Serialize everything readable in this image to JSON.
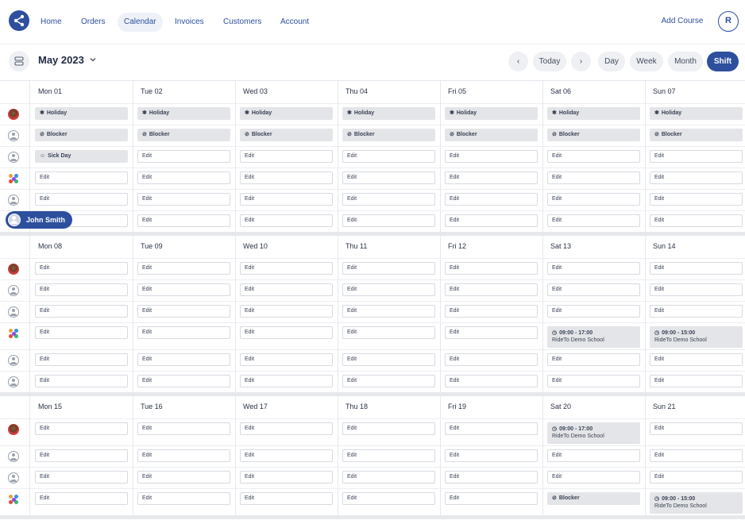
{
  "nav": {
    "items": [
      "Home",
      "Orders",
      "Calendar",
      "Invoices",
      "Customers",
      "Account"
    ],
    "active": "Calendar",
    "add_course": "Add Course",
    "account_initial": "R"
  },
  "toolbar": {
    "month": "May 2023",
    "today": "Today",
    "views": [
      "Day",
      "Week",
      "Month",
      "Shift"
    ],
    "active_view": "Shift"
  },
  "floating_label": "John Smith",
  "weeks": [
    {
      "days": [
        "Mon 01",
        "Tue 02",
        "Wed 03",
        "Thu 04",
        "Fri 05",
        "Sat 06",
        "Sun 07"
      ],
      "rows": [
        {
          "avatar": "photo",
          "cells": [
            {
              "type": "badge",
              "text": "Holiday",
              "icon": "holiday-icon"
            },
            {
              "type": "badge",
              "text": "Holiday",
              "icon": "holiday-icon"
            },
            {
              "type": "badge",
              "text": "Holiday",
              "icon": "holiday-icon"
            },
            {
              "type": "badge",
              "text": "Holiday",
              "icon": "holiday-icon"
            },
            {
              "type": "badge",
              "text": "Holiday",
              "icon": "holiday-icon"
            },
            {
              "type": "badge",
              "text": "Holiday",
              "icon": "holiday-icon"
            },
            {
              "type": "badge",
              "text": "Holiday",
              "icon": "holiday-icon"
            }
          ]
        },
        {
          "avatar": "generic",
          "cells": [
            {
              "type": "badge",
              "text": "Blocker",
              "icon": "blocker-icon"
            },
            {
              "type": "badge",
              "text": "Blocker",
              "icon": "blocker-icon"
            },
            {
              "type": "badge",
              "text": "Blocker",
              "icon": "blocker-icon"
            },
            {
              "type": "badge",
              "text": "Blocker",
              "icon": "blocker-icon"
            },
            {
              "type": "badge",
              "text": "Blocker",
              "icon": "blocker-icon"
            },
            {
              "type": "badge",
              "text": "Blocker",
              "icon": "blocker-icon"
            },
            {
              "type": "badge",
              "text": "Blocker",
              "icon": "blocker-icon"
            }
          ]
        },
        {
          "avatar": "generic",
          "cells": [
            {
              "type": "badge",
              "text": "Sick Day",
              "icon": "sick-day-icon"
            },
            {
              "type": "edit",
              "text": "Edit"
            },
            {
              "type": "edit",
              "text": "Edit"
            },
            {
              "type": "edit",
              "text": "Edit"
            },
            {
              "type": "edit",
              "text": "Edit"
            },
            {
              "type": "edit",
              "text": "Edit"
            },
            {
              "type": "edit",
              "text": "Edit"
            }
          ]
        },
        {
          "avatar": "colorful",
          "cells": [
            {
              "type": "edit",
              "text": "Edit"
            },
            {
              "type": "edit",
              "text": "Edit"
            },
            {
              "type": "edit",
              "text": "Edit"
            },
            {
              "type": "edit",
              "text": "Edit"
            },
            {
              "type": "edit",
              "text": "Edit"
            },
            {
              "type": "edit",
              "text": "Edit"
            },
            {
              "type": "edit",
              "text": "Edit"
            }
          ]
        },
        {
          "avatar": "generic",
          "cells": [
            {
              "type": "edit",
              "text": "Edit"
            },
            {
              "type": "edit",
              "text": "Edit"
            },
            {
              "type": "edit",
              "text": "Edit"
            },
            {
              "type": "edit",
              "text": "Edit"
            },
            {
              "type": "edit",
              "text": "Edit"
            },
            {
              "type": "edit",
              "text": "Edit"
            },
            {
              "type": "edit",
              "text": "Edit"
            }
          ]
        },
        {
          "avatar": "generic",
          "cells": [
            {
              "type": "edit",
              "text": "Edit"
            },
            {
              "type": "edit",
              "text": "Edit"
            },
            {
              "type": "edit",
              "text": "Edit"
            },
            {
              "type": "edit",
              "text": "Edit"
            },
            {
              "type": "edit",
              "text": "Edit"
            },
            {
              "type": "edit",
              "text": "Edit"
            },
            {
              "type": "edit",
              "text": "Edit"
            }
          ]
        }
      ]
    },
    {
      "days": [
        "Mon 08",
        "Tue 09",
        "Wed 10",
        "Thu 11",
        "Fri 12",
        "Sat 13",
        "Sun 14"
      ],
      "rows": [
        {
          "avatar": "photo",
          "cells": [
            {
              "type": "edit",
              "text": "Edit"
            },
            {
              "type": "edit",
              "text": "Edit"
            },
            {
              "type": "edit",
              "text": "Edit"
            },
            {
              "type": "edit",
              "text": "Edit"
            },
            {
              "type": "edit",
              "text": "Edit"
            },
            {
              "type": "edit",
              "text": "Edit"
            },
            {
              "type": "edit",
              "text": "Edit"
            }
          ]
        },
        {
          "avatar": "generic",
          "cells": [
            {
              "type": "edit",
              "text": "Edit"
            },
            {
              "type": "edit",
              "text": "Edit"
            },
            {
              "type": "edit",
              "text": "Edit"
            },
            {
              "type": "edit",
              "text": "Edit"
            },
            {
              "type": "edit",
              "text": "Edit"
            },
            {
              "type": "edit",
              "text": "Edit"
            },
            {
              "type": "edit",
              "text": "Edit"
            }
          ]
        },
        {
          "avatar": "generic",
          "cells": [
            {
              "type": "edit",
              "text": "Edit"
            },
            {
              "type": "edit",
              "text": "Edit"
            },
            {
              "type": "edit",
              "text": "Edit"
            },
            {
              "type": "edit",
              "text": "Edit"
            },
            {
              "type": "edit",
              "text": "Edit"
            },
            {
              "type": "edit",
              "text": "Edit"
            },
            {
              "type": "edit",
              "text": "Edit"
            }
          ]
        },
        {
          "avatar": "colorful",
          "tall": true,
          "cells": [
            {
              "type": "edit",
              "text": "Edit"
            },
            {
              "type": "edit",
              "text": "Edit"
            },
            {
              "type": "edit",
              "text": "Edit"
            },
            {
              "type": "edit",
              "text": "Edit"
            },
            {
              "type": "edit",
              "text": "Edit"
            },
            {
              "type": "shift",
              "time": "09:00 - 17:00",
              "place": "RideTo Demo School"
            },
            {
              "type": "shift",
              "time": "09:00 - 15:00",
              "place": "RideTo Demo School"
            }
          ]
        },
        {
          "avatar": "generic",
          "cells": [
            {
              "type": "edit",
              "text": "Edit"
            },
            {
              "type": "edit",
              "text": "Edit"
            },
            {
              "type": "edit",
              "text": "Edit"
            },
            {
              "type": "edit",
              "text": "Edit"
            },
            {
              "type": "edit",
              "text": "Edit"
            },
            {
              "type": "edit",
              "text": "Edit"
            },
            {
              "type": "edit",
              "text": "Edit"
            }
          ]
        },
        {
          "avatar": "generic",
          "cells": [
            {
              "type": "edit",
              "text": "Edit"
            },
            {
              "type": "edit",
              "text": "Edit"
            },
            {
              "type": "edit",
              "text": "Edit"
            },
            {
              "type": "edit",
              "text": "Edit"
            },
            {
              "type": "edit",
              "text": "Edit"
            },
            {
              "type": "edit",
              "text": "Edit"
            },
            {
              "type": "edit",
              "text": "Edit"
            }
          ]
        }
      ]
    },
    {
      "days": [
        "Mon 15",
        "Tue 16",
        "Wed 17",
        "Thu 18",
        "Fri 19",
        "Sat 20",
        "Sun 21"
      ],
      "rows": [
        {
          "avatar": "photo",
          "tall": true,
          "cells": [
            {
              "type": "edit",
              "text": "Edit"
            },
            {
              "type": "edit",
              "text": "Edit"
            },
            {
              "type": "edit",
              "text": "Edit"
            },
            {
              "type": "edit",
              "text": "Edit"
            },
            {
              "type": "edit",
              "text": "Edit"
            },
            {
              "type": "shift",
              "time": "09:00 - 17:00",
              "place": "RideTo Demo School"
            },
            {
              "type": "edit",
              "text": "Edit"
            }
          ]
        },
        {
          "avatar": "generic",
          "cells": [
            {
              "type": "edit",
              "text": "Edit"
            },
            {
              "type": "edit",
              "text": "Edit"
            },
            {
              "type": "edit",
              "text": "Edit"
            },
            {
              "type": "edit",
              "text": "Edit"
            },
            {
              "type": "edit",
              "text": "Edit"
            },
            {
              "type": "edit",
              "text": "Edit"
            },
            {
              "type": "edit",
              "text": "Edit"
            }
          ]
        },
        {
          "avatar": "generic",
          "cells": [
            {
              "type": "edit",
              "text": "Edit"
            },
            {
              "type": "edit",
              "text": "Edit"
            },
            {
              "type": "edit",
              "text": "Edit"
            },
            {
              "type": "edit",
              "text": "Edit"
            },
            {
              "type": "edit",
              "text": "Edit"
            },
            {
              "type": "edit",
              "text": "Edit"
            },
            {
              "type": "edit",
              "text": "Edit"
            }
          ]
        },
        {
          "avatar": "colorful",
          "tall": true,
          "cells": [
            {
              "type": "edit",
              "text": "Edit"
            },
            {
              "type": "edit",
              "text": "Edit"
            },
            {
              "type": "edit",
              "text": "Edit"
            },
            {
              "type": "edit",
              "text": "Edit"
            },
            {
              "type": "edit",
              "text": "Edit"
            },
            {
              "type": "badge",
              "text": "Blocker",
              "icon": "blocker-icon"
            },
            {
              "type": "shift",
              "time": "09:00 - 15:00",
              "place": "RideTo Demo School"
            }
          ]
        }
      ]
    }
  ]
}
